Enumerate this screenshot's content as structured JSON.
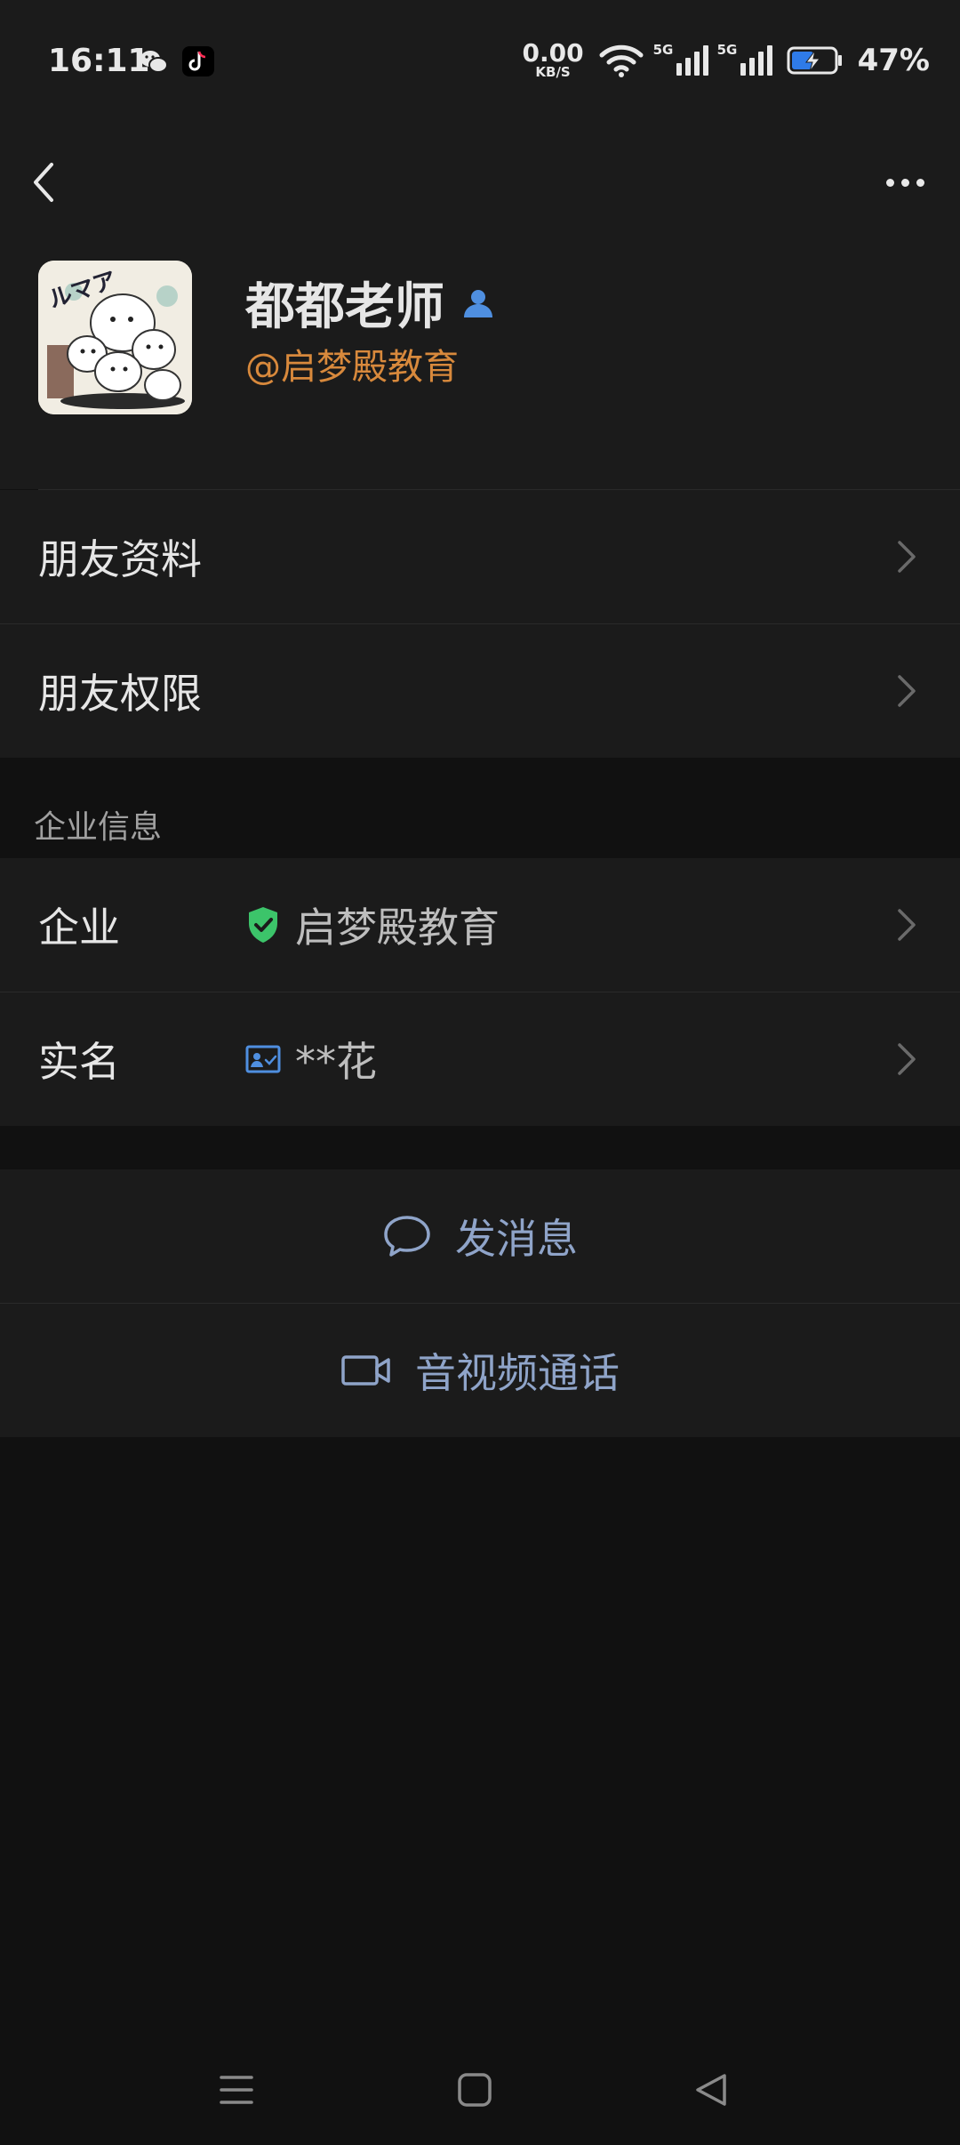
{
  "status_bar": {
    "time": "16:11",
    "net_speed_value": "0.00",
    "net_speed_unit": "KB/S",
    "signal_tag_1": "5G",
    "signal_tag_2": "5G",
    "battery": "47%",
    "app_icons": [
      "wechat-icon",
      "tiktok-icon"
    ]
  },
  "header": {
    "back_icon": "chevron-left-icon",
    "more_icon": "more-horizontal-icon"
  },
  "profile": {
    "name": "都都老师",
    "name_badge_icon": "contact-person-icon",
    "company_tag": "@启梦殿教育",
    "avatar_icon": "avatar-cartoon-image"
  },
  "menu": {
    "friend_info": "朋友资料",
    "friend_permissions": "朋友权限"
  },
  "enterprise_section": {
    "header": "企业信息",
    "company_label": "企业",
    "company_value": "启梦殿教育",
    "company_icon": "verified-shield-icon",
    "realname_label": "实名",
    "realname_value": "**花",
    "realname_icon": "id-card-icon"
  },
  "actions": {
    "send_message": "发消息",
    "av_call": "音视频通话"
  },
  "nav": {
    "menu_icon": "menu-icon",
    "home_icon": "home-square-icon",
    "back_icon": "back-triangle-icon"
  },
  "colors": {
    "accent_orange": "#d8893c",
    "action_blue": "#8fa4c9",
    "verified_green": "#3cc46a",
    "badge_blue": "#4f8fe0"
  }
}
